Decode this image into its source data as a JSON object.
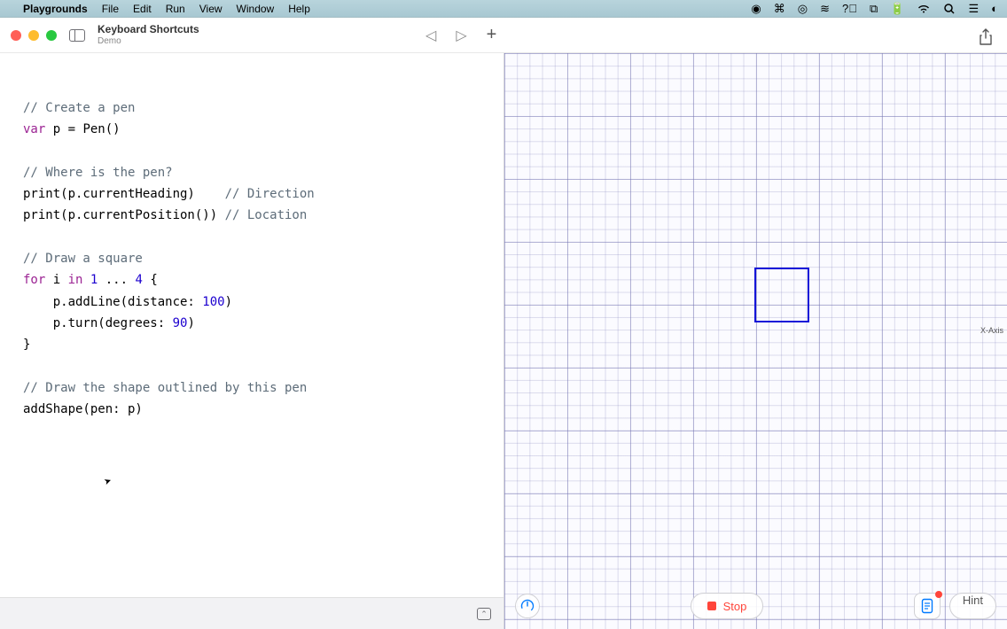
{
  "menubar": {
    "app": "Playgrounds",
    "items": [
      "File",
      "Edit",
      "Run",
      "View",
      "Window",
      "Help"
    ]
  },
  "window": {
    "title": "Keyboard Shortcuts",
    "subtitle": "Demo"
  },
  "code": {
    "l1": "// Create a pen",
    "l2a": "var",
    "l2b": " p = Pen()",
    "l3": "// Where is the pen?",
    "l4a": "print(p.currentHeading)    ",
    "l4b": "// Direction",
    "l5a": "print(p.currentPosition()) ",
    "l5b": "// Location",
    "l6": "// Draw a square",
    "l7a": "for",
    "l7b": " i ",
    "l7c": "in",
    "l7d": " ",
    "l7e": "1",
    "l7f": " ... ",
    "l7g": "4",
    "l7h": " {",
    "l8a": "    p.addLine(distance: ",
    "l8b": "100",
    "l8c": ")",
    "l9a": "    p.turn(degrees: ",
    "l9b": "90",
    "l9c": ")",
    "l10": "}",
    "l11": "// Draw the shape outlined by this pen",
    "l12": "addShape(pen: p)"
  },
  "liveview": {
    "axis_label": "X-Axis",
    "stop_label": "Stop",
    "hint_label": "Hint"
  }
}
